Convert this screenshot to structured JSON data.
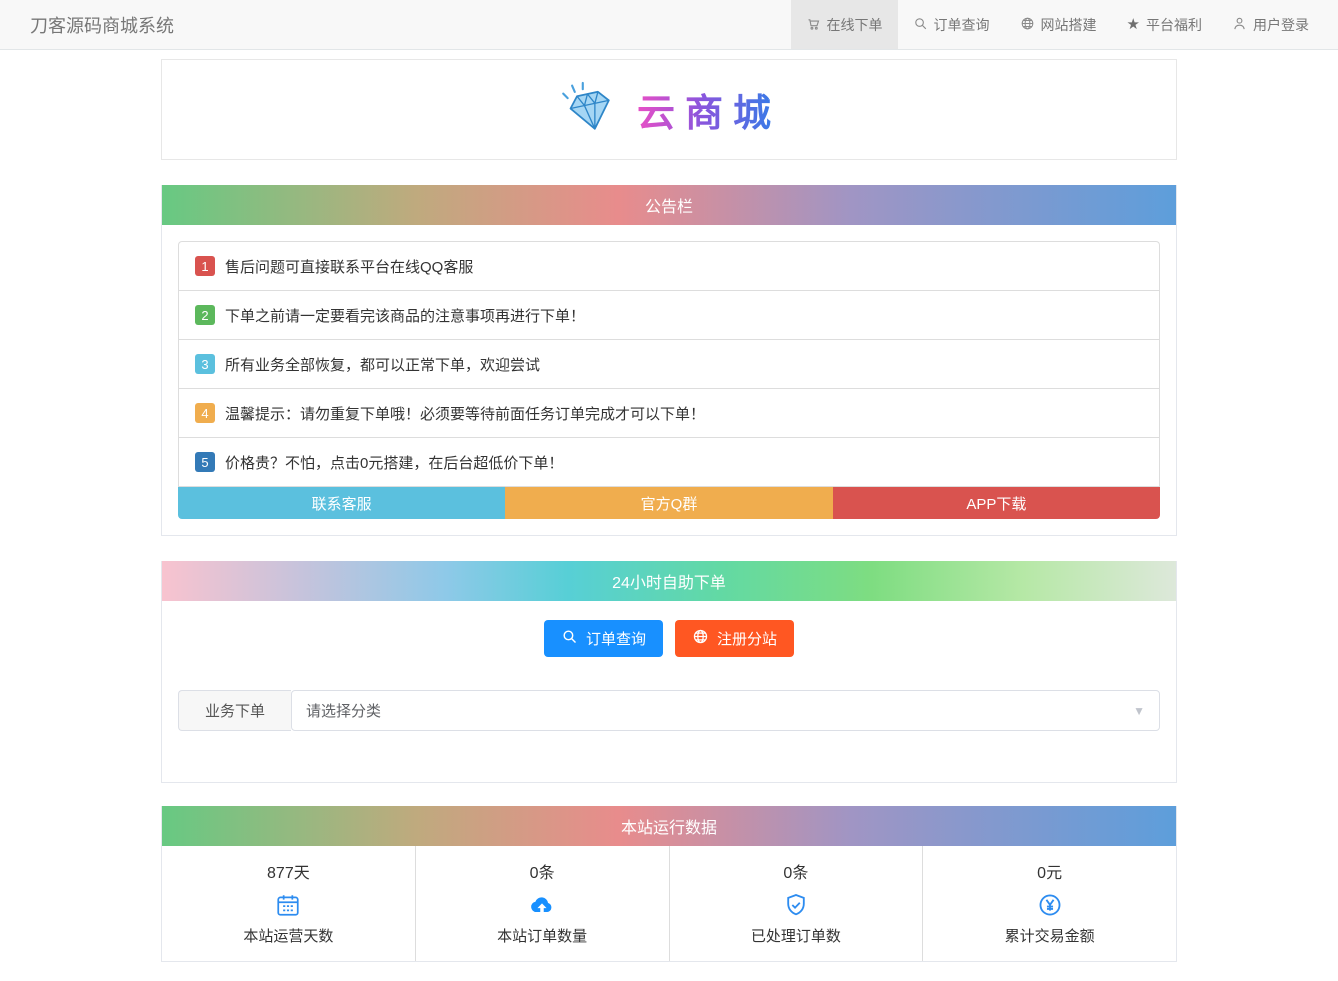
{
  "navbar": {
    "brand": "刀客源码商城系统",
    "items": [
      {
        "label": "在线下单",
        "icon": "cart-icon",
        "active": true
      },
      {
        "label": "订单查询",
        "icon": "search-icon",
        "active": false
      },
      {
        "label": "网站搭建",
        "icon": "globe-icon",
        "active": false
      },
      {
        "label": "平台福利",
        "icon": "star-icon",
        "active": false
      },
      {
        "label": "用户登录",
        "icon": "user-icon",
        "active": false
      }
    ]
  },
  "logo": {
    "site_name": "云商城",
    "icon": "diamond-icon"
  },
  "announcement": {
    "title": "公告栏",
    "items": [
      {
        "num": "1",
        "text": "售后问题可直接联系平台在线QQ客服",
        "color": "#d9534f"
      },
      {
        "num": "2",
        "text": "下单之前请一定要看完该商品的注意事项再进行下单！",
        "color": "#5cb85c"
      },
      {
        "num": "3",
        "text": "所有业务全部恢复，都可以正常下单，欢迎尝试",
        "color": "#5bc0de"
      },
      {
        "num": "4",
        "text": "温馨提示：请勿重复下单哦！必须要等待前面任务订单完成才可以下单！",
        "color": "#f0ad4e"
      },
      {
        "num": "5",
        "text": "价格贵？不怕，点击0元搭建，在后台超低价下单！",
        "color": "#337ab7"
      }
    ],
    "buttons": [
      {
        "label": "联系客服",
        "color": "#5bc0de"
      },
      {
        "label": "官方Q群",
        "color": "#f0ad4e"
      },
      {
        "label": "APP下载",
        "color": "#d9534f"
      }
    ]
  },
  "self_order": {
    "title": "24小时自助下单",
    "buttons": [
      {
        "label": "订单查询",
        "icon": "search-icon",
        "color": "#1890ff"
      },
      {
        "label": "注册分站",
        "icon": "globe-icon",
        "color": "#ff5722"
      }
    ],
    "order_row": {
      "label": "业务下单",
      "selected": "请选择分类"
    }
  },
  "stats": {
    "title": "本站运行数据",
    "items": [
      {
        "value": "877天",
        "icon": "calendar-icon",
        "label": "本站运营天数",
        "icon_color": "#2d8cf0"
      },
      {
        "value": "0条",
        "icon": "cloud-upload-icon",
        "label": "本站订单数量",
        "icon_color": "#1890ff"
      },
      {
        "value": "0条",
        "icon": "shield-check-icon",
        "label": "已处理订单数",
        "icon_color": "#2d8cf0"
      },
      {
        "value": "0元",
        "icon": "yen-circle-icon",
        "label": "累计交易金额",
        "icon_color": "#2d8cf0"
      }
    ]
  },
  "theme": {
    "nav_bg": "#f8f8f8",
    "nav_active_bg": "#e7e7e7",
    "header_gradient_warm": [
      "#67c982",
      "#bfaa7e",
      "#e88c8c",
      "#a095c4",
      "#5d9edb"
    ],
    "header_gradient_cool": [
      "#f8c3cf",
      "#8ec9e8",
      "#57cfd6",
      "#7edd81",
      "#dde8da"
    ],
    "logo_text_gradient": [
      "#e84fc6",
      "#8a55dd",
      "#2f7fe8"
    ],
    "stat_icon_blue": "#2d8cf0"
  }
}
